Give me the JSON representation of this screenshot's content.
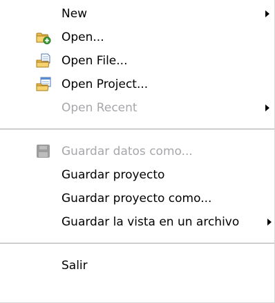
{
  "menu": {
    "items": [
      {
        "label": "New",
        "enabled": true,
        "submenu": true,
        "icon": null
      },
      {
        "label": "Open...",
        "enabled": true,
        "submenu": false,
        "icon": "folder-open-icon"
      },
      {
        "label": "Open File...",
        "enabled": true,
        "submenu": false,
        "icon": "open-file-icon"
      },
      {
        "label": "Open Project...",
        "enabled": true,
        "submenu": false,
        "icon": "open-project-icon"
      },
      {
        "label": "Open Recent",
        "enabled": false,
        "submenu": true,
        "icon": null
      },
      {
        "label": "Guardar datos como...",
        "enabled": false,
        "submenu": false,
        "icon": "save-disk-icon"
      },
      {
        "label": "Guardar proyecto",
        "enabled": true,
        "submenu": false,
        "icon": null
      },
      {
        "label": "Guardar proyecto como...",
        "enabled": true,
        "submenu": false,
        "icon": null
      },
      {
        "label": "Guardar la vista en un archivo",
        "enabled": true,
        "submenu": true,
        "icon": null
      },
      {
        "label": "Salir",
        "enabled": true,
        "submenu": false,
        "icon": null
      }
    ]
  },
  "colors": {
    "text": "#000000",
    "disabled_text": "#a7a6aa",
    "separator": "#a6a6a6",
    "background": "#ffffff"
  }
}
